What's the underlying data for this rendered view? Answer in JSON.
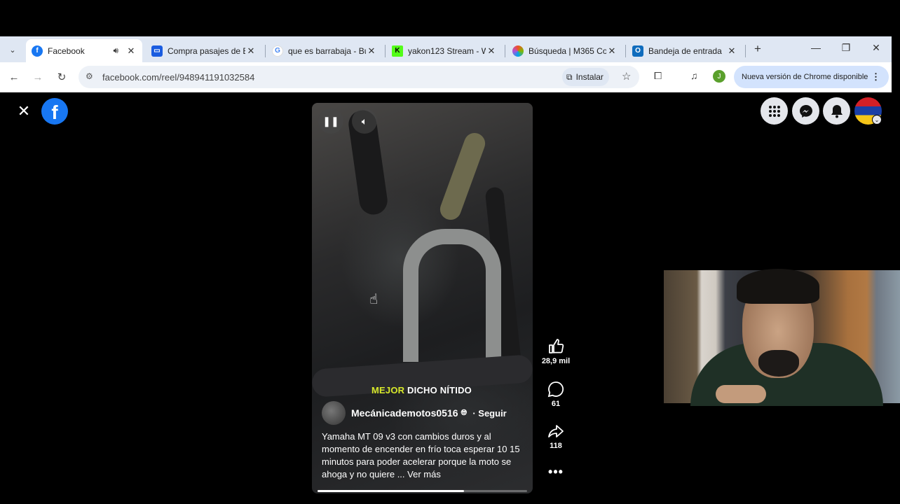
{
  "browser": {
    "tabs": [
      {
        "title": "Facebook",
        "favicon_color": "#1877f2",
        "active": true,
        "audio": true
      },
      {
        "title": "Compra pasajes de B",
        "favicon_color": "#1a5ce0",
        "active": false
      },
      {
        "title": "que es barrabaja - Bu",
        "favicon_color": "#ffffff",
        "active": false
      },
      {
        "title": "yakon123 Stream - W",
        "favicon_color": "#53fc18",
        "active": false
      },
      {
        "title": "Búsqueda | M365 Co",
        "favicon_color": "#b250d8",
        "active": false
      },
      {
        "title": "Bandeja de entrada",
        "favicon_color": "#0f6cbd",
        "active": false
      }
    ],
    "url": "facebook.com/reel/948941191032584",
    "install_label": "Instalar",
    "profile_initial": "J",
    "update_label": "Nueva versión de Chrome disponible"
  },
  "facebook": {
    "reel": {
      "overlay_caption_highlight": "MEJOR",
      "overlay_caption_rest": " DICHO NÍTIDO",
      "author": "Mecánicademotos0516",
      "follow_label": "· Seguir",
      "description": "Yamaha MT 09 v3 con cambios duros y al momento de encender en frío toca esperar 10 15 minutos para poder acelerar porque la moto se ahoga y no quiere ...",
      "see_more": "Ver más",
      "progress": 0.7
    },
    "actions": {
      "likes": "28,9 mil",
      "comments": "61",
      "shares": "118"
    },
    "accent": "#1877f2"
  }
}
